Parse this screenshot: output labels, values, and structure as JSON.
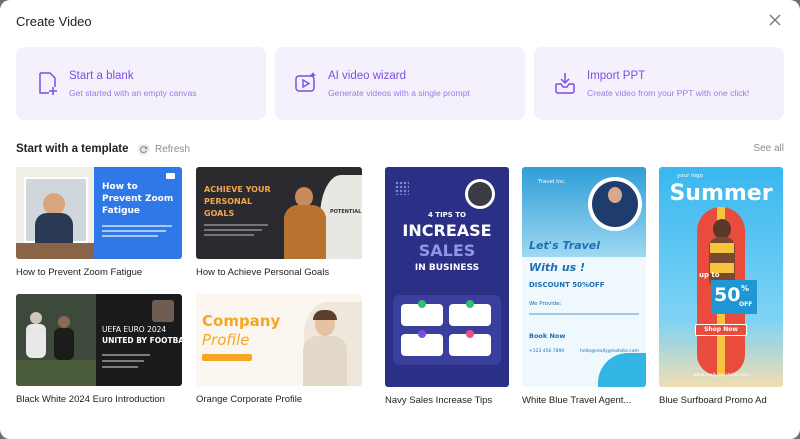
{
  "dialog": {
    "title": "Create Video"
  },
  "actions": [
    {
      "title": "Start a blank",
      "subtitle": "Get started with an empty canvas",
      "icon": "new-file-icon"
    },
    {
      "title": "AI video wizard",
      "subtitle": "Generate videos with a single prompt",
      "icon": "ai-video-icon"
    },
    {
      "title": "Import PPT",
      "subtitle": "Create video from your PPT with one click!",
      "icon": "import-icon"
    }
  ],
  "templates_section": {
    "title": "Start with a template",
    "refresh_label": "Refresh",
    "see_all_label": "See all"
  },
  "templates": [
    {
      "name": "How to Prevent Zoom Fatigue",
      "thumb_text": [
        "How to",
        "Prevent Zoom",
        "Fatigue"
      ]
    },
    {
      "name": "How to Achieve Personal Goals",
      "thumb_text": [
        "ACHIEVE YOUR",
        "PERSONAL",
        "GOALS"
      ],
      "thumb_badge": "POTENTIAL"
    },
    {
      "name": "Black White 2024 Euro Introduction",
      "thumb_text": [
        "UEFA EURO 2024",
        "UNITED BY FOOTBALL"
      ]
    },
    {
      "name": "Orange Corporate Profile",
      "thumb_text": [
        "Company",
        "Profile"
      ]
    },
    {
      "name": "Navy Sales Increase Tips",
      "thumb_text": [
        "4 TIPS TO",
        "INCREASE",
        "SALES",
        "IN BUSINESS"
      ]
    },
    {
      "name": "White Blue Travel Agent...",
      "thumb_text": [
        "Travel Inc.",
        "Let's Travel",
        "With us !",
        "DISCOUNT 50%OFF",
        "We Provide:",
        "Book Now",
        "+123 456 7890",
        "hello@reallygreatsite.com"
      ]
    },
    {
      "name": "Blue Surfboard Promo Ad",
      "thumb_text": [
        "your logo",
        "Summer",
        "up to",
        "50",
        "%",
        "OFF",
        "Shop Now",
        "www.reallygreatsite.com"
      ]
    }
  ],
  "colors": {
    "accent": "#7b4fe3",
    "card_bg": "#f4f1fd",
    "zoom_blue": "#2f78e8",
    "navy": "#2b2f86",
    "orange": "#f5a623",
    "sky": "#39b7ef"
  }
}
